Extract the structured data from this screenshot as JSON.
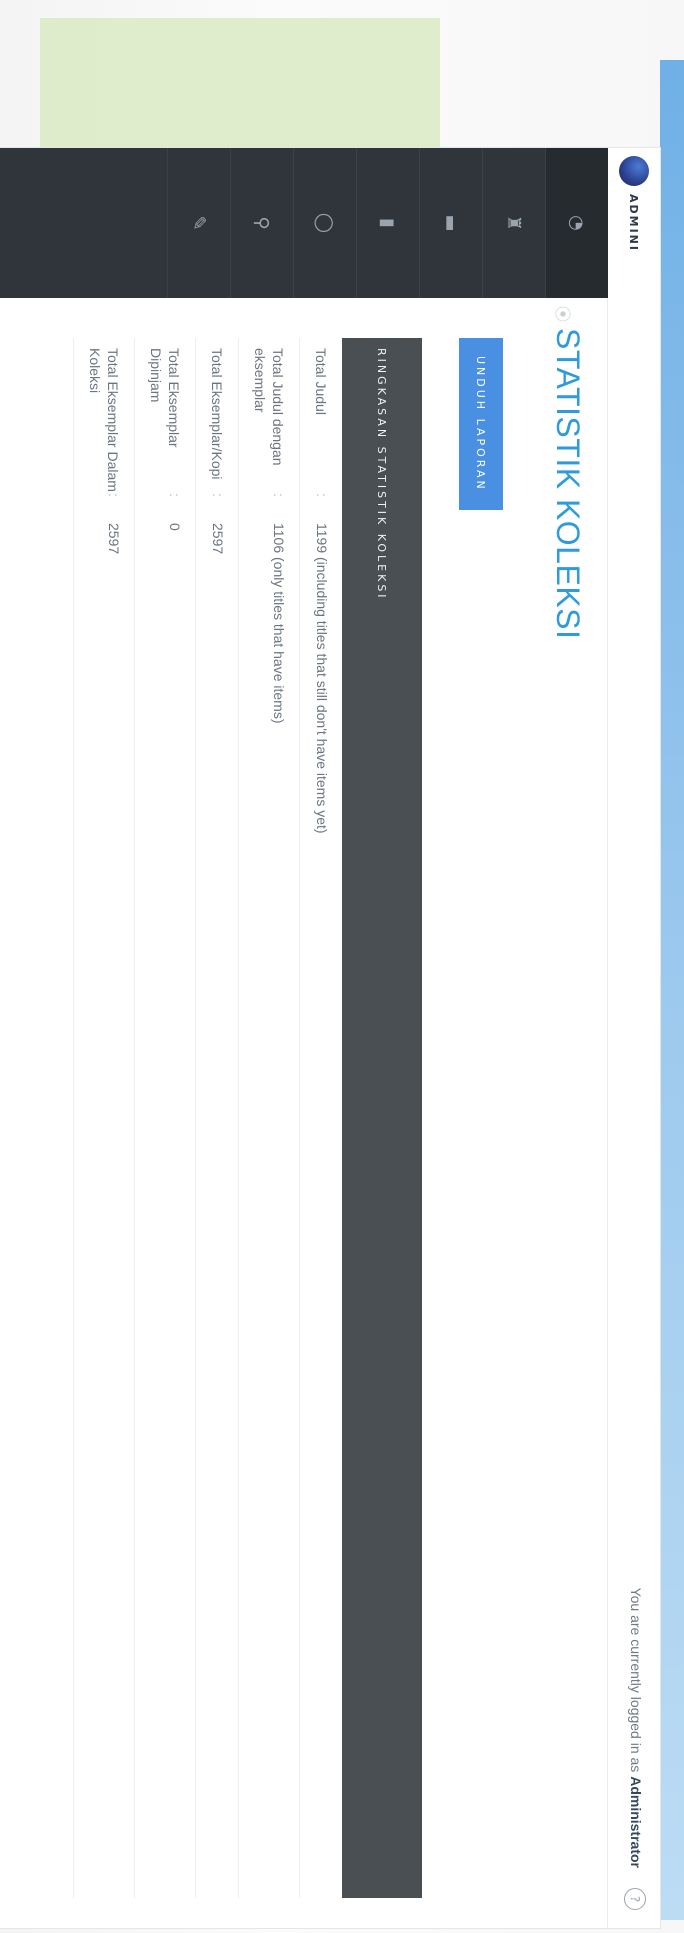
{
  "brand": {
    "name": "ADMINI"
  },
  "header": {
    "logged_prefix": "You are currently logged in as ",
    "logged_user": "Administrator",
    "help_icon": "?"
  },
  "sidebar": {
    "items": [
      {
        "icon": "dashboard-icon",
        "glyph": "◔"
      },
      {
        "icon": "bibliography-icon",
        "glyph": "♜"
      },
      {
        "icon": "membership-icon",
        "glyph": "▬"
      },
      {
        "icon": "circulation-icon",
        "glyph": "▮"
      },
      {
        "icon": "stock-take-icon",
        "glyph": "◯"
      },
      {
        "icon": "reporting-icon",
        "glyph": "⚲"
      },
      {
        "icon": "system-icon",
        "glyph": "✎"
      }
    ]
  },
  "page": {
    "title": "STATISTIK KOLEKSI",
    "download_label": "UNDUH LAPORAN"
  },
  "summary": {
    "header": "RINGKASAN STATISTIK KOLEKSI",
    "rows": [
      {
        "label": "Total Judul",
        "value": "1199 (including titles that still don't have items yet)"
      },
      {
        "label": "Total Judul dengan eksemplar",
        "value": "1106 (only titles that have items)"
      },
      {
        "label": "Total Eksemplar/Kopi",
        "value": "2597"
      },
      {
        "label": "Total Eksemplar Dipinjam",
        "value": "0"
      },
      {
        "label": "Total Eksemplar Dalam Koleksi",
        "value": "2597"
      }
    ]
  }
}
